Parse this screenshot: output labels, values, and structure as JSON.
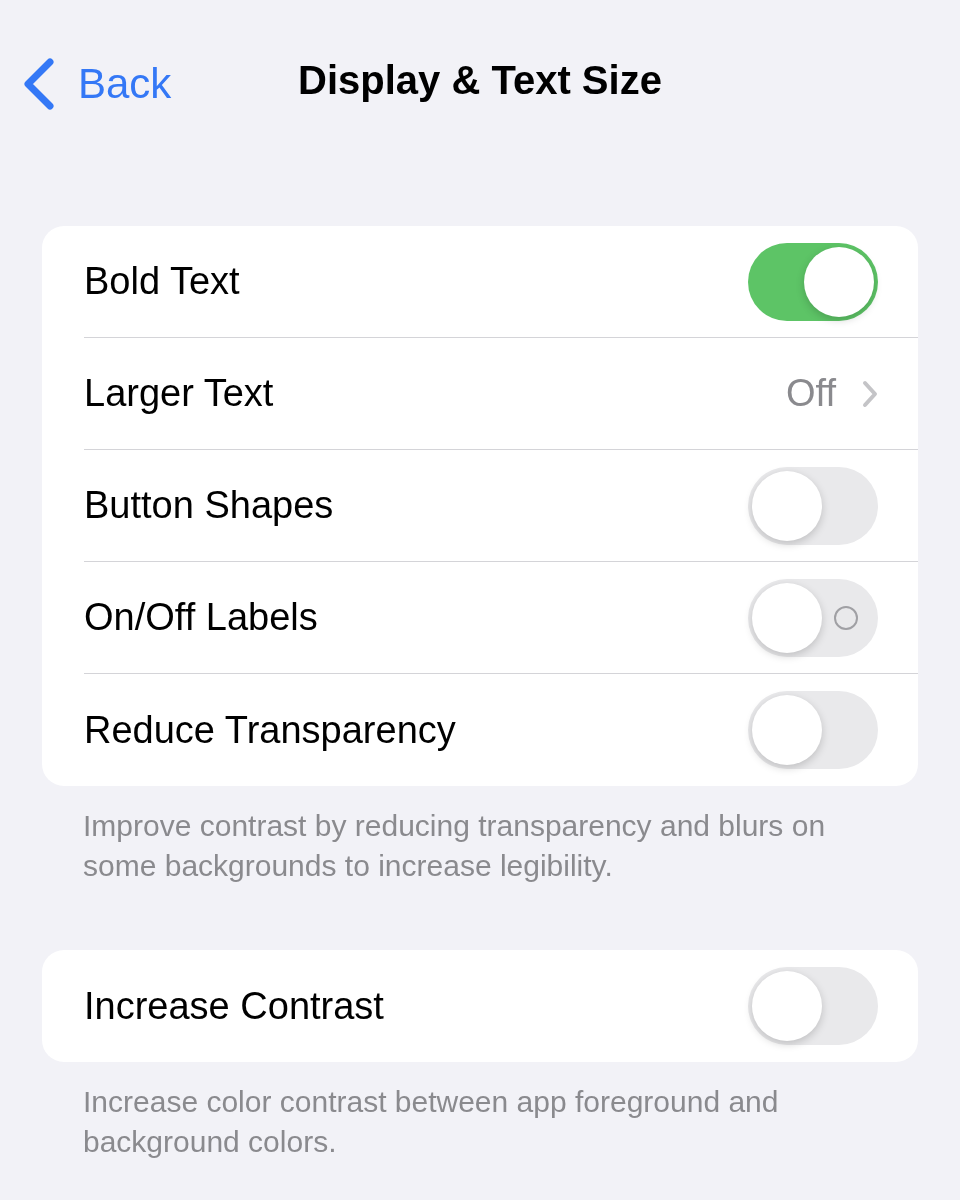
{
  "nav": {
    "back": "Back",
    "title": "Display & Text Size"
  },
  "groups": [
    {
      "rows": [
        {
          "kind": "toggle",
          "label": "Bold Text",
          "on": true,
          "glyph": false
        },
        {
          "kind": "link",
          "label": "Larger Text",
          "value": "Off"
        },
        {
          "kind": "toggle",
          "label": "Button Shapes",
          "on": false,
          "glyph": false
        },
        {
          "kind": "toggle",
          "label": "On/Off Labels",
          "on": false,
          "glyph": true
        },
        {
          "kind": "toggle",
          "label": "Reduce Transparency",
          "on": false,
          "glyph": false
        }
      ],
      "footer": "Improve contrast by reducing transparency and blurs on some backgrounds to increase legibility."
    },
    {
      "rows": [
        {
          "kind": "toggle",
          "label": "Increase Contrast",
          "on": false,
          "glyph": false
        }
      ],
      "footer": "Increase color contrast between app foreground and background colors."
    }
  ]
}
